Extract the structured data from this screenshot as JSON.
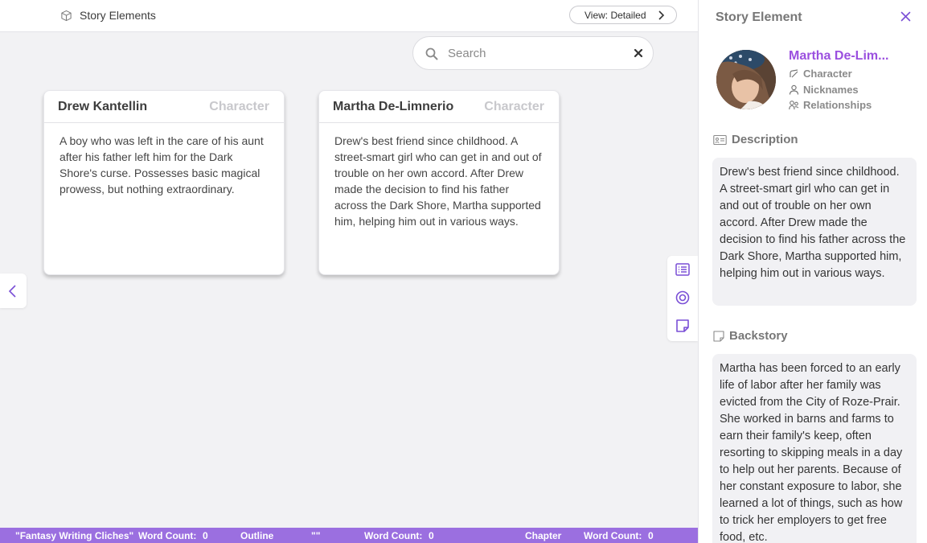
{
  "topbar": {
    "title": "Story Elements",
    "view_label": "View: Detailed"
  },
  "search": {
    "placeholder": "Search",
    "value": ""
  },
  "cards": [
    {
      "name": "Drew Kantellin",
      "type": "Character",
      "description": "A boy who was left in the care of his aunt after his father left him for the Dark Shore's curse. Possesses basic magical prowess, but nothing extraordinary."
    },
    {
      "name": "Martha De-Limnerio",
      "type": "Character",
      "description": "Drew's best friend since childhood. A street-smart girl who can get in and out of trouble on her own accord. After Drew made the decision to find his father across the Dark Shore, Martha supported him, helping him out in various ways."
    }
  ],
  "statusbar": {
    "project": "\"Fantasy Writing Cliches\"",
    "wc_label_1": "Word Count:",
    "wc_value_1": "0",
    "outline": "Outline",
    "quote": "\"\"",
    "wc_label_2": "Word Count:",
    "wc_value_2": "0",
    "chapter": "Chapter",
    "wc_label_3": "Word Count:",
    "wc_value_3": "0"
  },
  "panel": {
    "title": "Story Element",
    "element_name": "Martha De-Lim...",
    "type": "Character",
    "nicknames": "Nicknames",
    "relationships": "Relationships",
    "description_heading": "Description",
    "description": "Drew's best friend since childhood. A street-smart girl who can get in and out of trouble on her own accord. After Drew made the decision to find his father across the Dark Shore, Martha supported him, helping him out in various ways.",
    "backstory_heading": "Backstory",
    "backstory": "Martha has been forced to an early life of labor after her family was evicted from the City of Roze-Prair. She worked in barns and farms to earn their family's keep, often resorting to skipping meals in a day to help out her parents. Because of her constant exposure to labor, she learned a lot of things, such as how to trick her employers to get free food, etc."
  },
  "colors": {
    "accent": "#9b6fe0",
    "name_purple": "#9b50df",
    "icon_purple": "#7a4fd6"
  }
}
